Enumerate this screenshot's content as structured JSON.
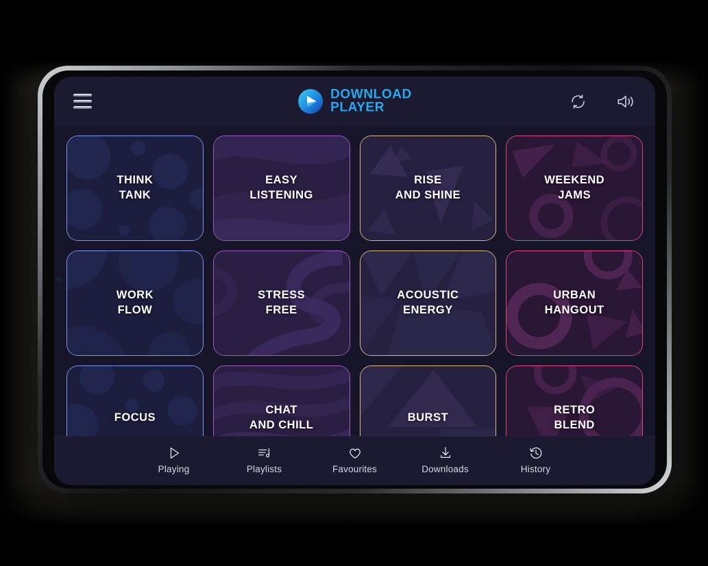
{
  "app": {
    "brand_line1": "DOWNLOAD",
    "brand_line2": "PLAYER",
    "brand_color": "#2aa7ee",
    "screen_bg": "#161529",
    "bar_bg": "#1b1a30"
  },
  "header": {
    "menu_label": "menu",
    "refresh_label": "refresh",
    "volume_label": "volume"
  },
  "tiles": [
    {
      "title": "THINK\nTANK",
      "accent": "blue",
      "accent_color": "#7d97e8",
      "art": "bubbles"
    },
    {
      "title": "EASY\nLISTENING",
      "accent": "purple",
      "accent_color": "#9a5fc0",
      "art": "waves"
    },
    {
      "title": "RISE\nAND SHINE",
      "accent": "gold",
      "accent_color": "#dcb97f",
      "art": "triangles"
    },
    {
      "title": "WEEKEND\nJAMS",
      "accent": "pink",
      "accent_color": "#e0487e",
      "art": "rings"
    },
    {
      "title": "WORK\nFLOW",
      "accent": "blue",
      "accent_color": "#7d97e8",
      "art": "blobs"
    },
    {
      "title": "STRESS\nFREE",
      "accent": "purple",
      "accent_color": "#9a5fc0",
      "art": "swirl"
    },
    {
      "title": "ACOUSTIC\nENERGY",
      "accent": "gold",
      "accent_color": "#dcb97f",
      "art": "facets"
    },
    {
      "title": "URBAN\nHANGOUT",
      "accent": "pink",
      "accent_color": "#e0487e",
      "art": "rings"
    },
    {
      "title": "FOCUS",
      "accent": "blue",
      "accent_color": "#7d97e8",
      "art": "bubbles"
    },
    {
      "title": "CHAT\nAND CHILL",
      "accent": "purple",
      "accent_color": "#9a5fc0",
      "art": "waves"
    },
    {
      "title": "BURST",
      "accent": "gold",
      "accent_color": "#dcb97f",
      "art": "triangles"
    },
    {
      "title": "RETRO\nBLEND",
      "accent": "pink",
      "accent_color": "#e0487e",
      "art": "rings"
    }
  ],
  "bottom_nav": [
    {
      "label": "Playing",
      "icon": "play-icon"
    },
    {
      "label": "Playlists",
      "icon": "playlist-icon"
    },
    {
      "label": "Favourites",
      "icon": "heart-icon"
    },
    {
      "label": "Downloads",
      "icon": "download-icon"
    },
    {
      "label": "History",
      "icon": "history-icon"
    }
  ]
}
